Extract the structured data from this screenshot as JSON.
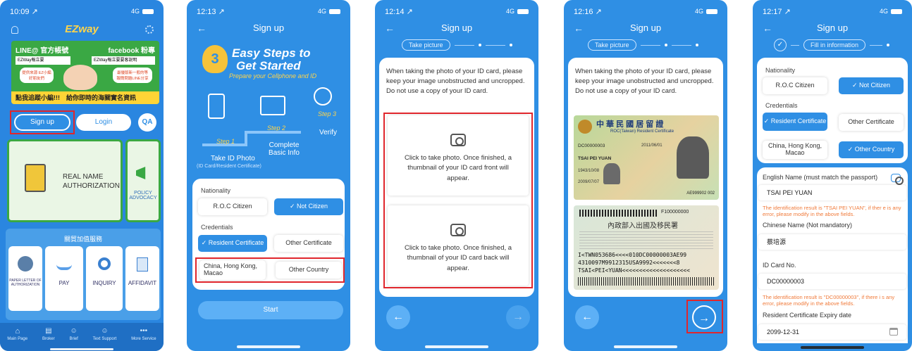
{
  "colors": {
    "primary": "#2f8fe4",
    "highlight": "#e0262c",
    "warning": "#f07a3a"
  },
  "s1": {
    "time": "10:09 ↗",
    "signal": "4G",
    "brand": "EZway",
    "banner_line": "LINE@ 官方帳號",
    "banner_fb": "facebook 粉專",
    "banner_left_search": "EZWay報立要",
    "banner_right_search": "EZWay報立要要客說明",
    "bubble_left": "提供來源 EZ小編好朋友們",
    "bubble_right": "最優版新一般的等 報簡問題LINE分享",
    "banner_bottom": "點我追蹤小編!!!　給你即時的海關實名資訊",
    "signup": "Sign up",
    "login": "Login",
    "qa": "QA",
    "realname": "REAL NAME AUTHORIZATION",
    "policy": "POLICY ADVOCACY",
    "services_title": "關貿加值服務",
    "tiles": [
      "PAPER LETTER OF AUTHORIZATION",
      "PAY",
      "INQUIRY",
      "AFFIDAVIT"
    ],
    "nav": [
      "Main Page",
      "Broker",
      "Brief",
      "Text Support",
      "More Service"
    ]
  },
  "s2": {
    "time": "12:13 ↗",
    "signal": "4G",
    "title": "Sign up",
    "easy": "Easy Steps to",
    "getstarted": "Get Started",
    "prepare": "Prepare your Cellphone and ID",
    "step1": "Step 1",
    "step2": "Step 2",
    "step3": "Step 3",
    "take_id": "Take ID Photo",
    "take_id_sub": "(ID Card/Resident Certificate)",
    "basic": "Complete Basic Info",
    "verify": "Verify",
    "nationality": "Nationality",
    "roc": "R.O.C Citizen",
    "not_citizen": "✓ Not Citizen",
    "credentials": "Credentials",
    "resident": "✓ Resident Certificate",
    "other_cert": "Other Certificate",
    "china": "China, Hong Kong, Macao",
    "other_country": "Other Country",
    "start": "Start"
  },
  "s3": {
    "time": "12:14 ↗",
    "signal": "4G",
    "title": "Sign up",
    "step": "Take picture",
    "instructions": "When taking the photo of your ID card, please keep your image unobstructed and uncropped. Do not use a copy of your ID card.",
    "front": "Click to take photo. Once finished, a thumbnail of your ID card front will appear.",
    "back_text": "Click to take photo. Once finished, a thumbnail of your ID card back will appear."
  },
  "s4": {
    "time": "12:16 ↗",
    "signal": "4G",
    "title": "Sign up",
    "step": "Take picture",
    "instructions": "When taking the photo of your ID card, please keep your image unobstructed and uncropped. Do not use a copy of your ID card.",
    "card_title": "中 華 民 國 居 留 證",
    "card_sub": "ROC(Taiwan) Resident Certificate",
    "card_number": "DC00000003",
    "card_name": "TSAI PEI YUAN",
    "card_dates": [
      "2011/06/01",
      "1943/10/08",
      "2009/07/07"
    ],
    "card_code": "AE999902 002",
    "back_title": "內政部入出國及移民署",
    "back_number": "F100000000",
    "mrz": [
      "I<TWN053686<<<<010DC00000003AE99",
      "4310097M9912315USA9992<<<<<<<8",
      "TSAI<PEI<YUAN<<<<<<<<<<<<<<<<<<<<"
    ]
  },
  "s5": {
    "time": "12:17 ↗",
    "signal": "4G",
    "title": "Sign up",
    "step": "Fill in information",
    "nationality": "Nationality",
    "roc": "R.O.C Citizen",
    "not_citizen": "✓ Not Citizen",
    "credentials": "Credentials",
    "resident": "✓ Resident Certificate",
    "other_cert": "Other Certificate",
    "china": "China, Hong Kong, Macao",
    "other_country": "✓ Other Country",
    "english_label": "English Name (must match the passport)",
    "english_value": "TSAI PEI YUAN",
    "english_warn": "The identification result is \"TSAI PEI YUAN\", if ther e is any error, please modify in the above fields.",
    "chinese_label": "Chinese Name (Not mandatory)",
    "chinese_value": "蔡培源",
    "id_label": "ID Card No.",
    "id_value": "DC00000003",
    "id_warn": "The identification result is \"DC00000003\", if there i s any error, please modify in the above fields.",
    "expiry_label": "Resident Certificate Expiry date",
    "expiry_value": "2099-12-31"
  }
}
